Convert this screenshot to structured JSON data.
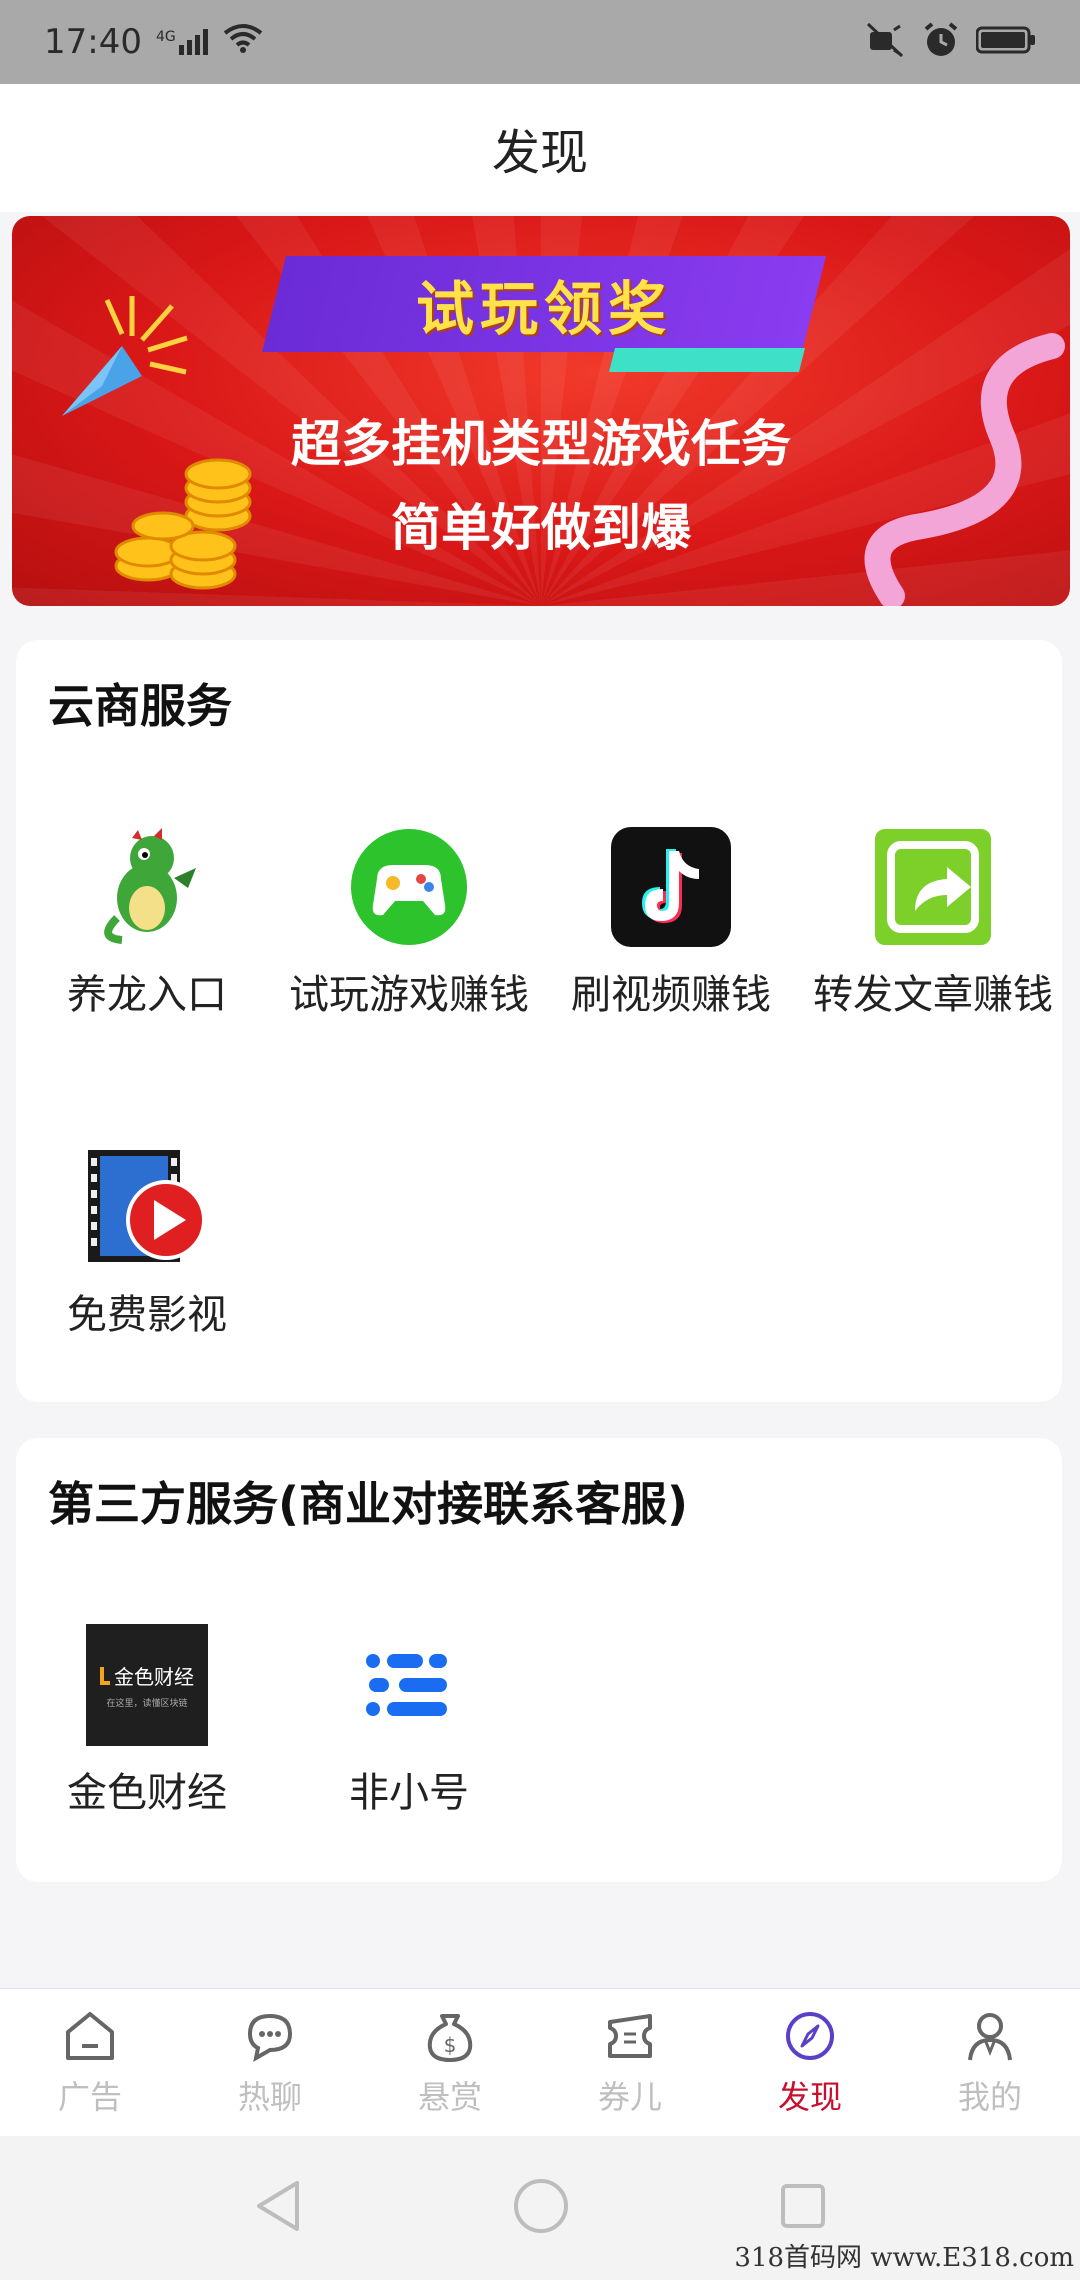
{
  "status_bar": {
    "time": "17:40",
    "network": "4G",
    "icons": [
      "signal-icon",
      "wifi-icon",
      "mute-icon",
      "alarm-icon",
      "battery-icon"
    ]
  },
  "header": {
    "title": "发现"
  },
  "banner": {
    "headline": "试玩领奖",
    "line1": "超多挂机类型游戏任务",
    "line2": "简单好做到爆"
  },
  "section_cloud": {
    "title": "云商服务",
    "items": [
      {
        "label": "养龙入口",
        "icon": "dragon-icon"
      },
      {
        "label": "试玩游戏赚钱",
        "icon": "gamepad-icon"
      },
      {
        "label": "刷视频赚钱",
        "icon": "tiktok-icon"
      },
      {
        "label": "转发文章赚钱",
        "icon": "share-icon"
      },
      {
        "label": "免费影视",
        "icon": "video-play-icon"
      }
    ]
  },
  "section_third": {
    "title": "第三方服务(商业对接联系客服)",
    "items": [
      {
        "label": "金色财经",
        "icon": "jinse-logo-icon",
        "logo_text": "金色财经",
        "logo_sub": "在这里，读懂区块链"
      },
      {
        "label": "非小号",
        "icon": "feixiaohao-icon"
      }
    ]
  },
  "bottom_nav": {
    "items": [
      {
        "label": "广告",
        "icon": "home-icon",
        "active": false
      },
      {
        "label": "热聊",
        "icon": "chat-icon",
        "active": false
      },
      {
        "label": "悬赏",
        "icon": "money-bag-icon",
        "active": false
      },
      {
        "label": "券儿",
        "icon": "ticket-icon",
        "active": false
      },
      {
        "label": "发现",
        "icon": "compass-icon",
        "active": true
      },
      {
        "label": "我的",
        "icon": "user-icon",
        "active": false
      }
    ]
  },
  "watermark": "318首码网 www.E318.com",
  "colors": {
    "accent": "#c8102e",
    "banner_red": "#d91717",
    "ribbon_purple": "#7a33e6"
  }
}
